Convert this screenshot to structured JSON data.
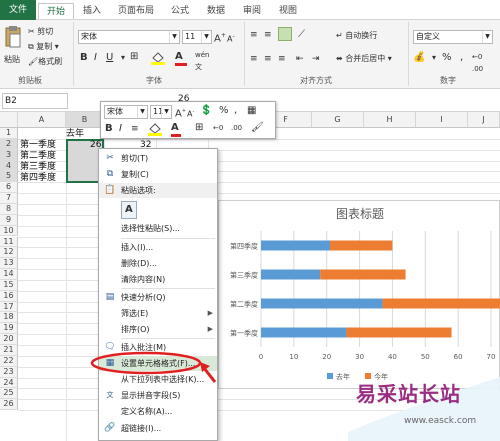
{
  "tabs": [
    "文件",
    "开始",
    "插入",
    "页面布局",
    "公式",
    "数据",
    "审阅",
    "视图"
  ],
  "ribbon": {
    "paste_label": "粘贴",
    "clipboard_items": [
      "剪切",
      "复制",
      "格式刷"
    ],
    "font_name": "宋体",
    "font_size": "11",
    "wrap_text": "自动换行",
    "merge_center": "合并后居中",
    "number_format": "自定义",
    "groups": [
      "剪贴板",
      "字体",
      "对齐方式",
      "数字"
    ],
    "icons": [
      "scissors-icon",
      "copy-icon",
      "brush-icon",
      "bold-icon",
      "italic-icon",
      "underline-icon",
      "border-icon",
      "fill-color-icon",
      "font-color-icon",
      "align-icon",
      "wrap-icon",
      "merge-icon",
      "currency-icon",
      "percent-icon",
      "comma-icon"
    ]
  },
  "formula_bar": {
    "name_box": "B2",
    "value": "26"
  },
  "mini_toolbar": {
    "font": "宋体",
    "size": "11",
    "percent": "%"
  },
  "columns": [
    "A",
    "B",
    "C",
    "D",
    "E",
    "F",
    "G",
    "H",
    "I",
    "J"
  ],
  "rows": [
    "1",
    "2",
    "3",
    "4",
    "5",
    "6",
    "7",
    "8",
    "9",
    "10",
    "11",
    "12",
    "13",
    "14",
    "15",
    "16",
    "17",
    "18",
    "19",
    "20",
    "21",
    "22",
    "23",
    "24",
    "25",
    "26"
  ],
  "cells": {
    "b1": "去年",
    "a2": "第一季度",
    "a3": "第二季度",
    "a4": "第三季度",
    "a5": "第四季度",
    "b2": "26",
    "c2": "32"
  },
  "context_menu": {
    "items": [
      {
        "label": "剪切(T)",
        "icon": "scissors-icon"
      },
      {
        "label": "复制(C)",
        "icon": "copy-icon"
      },
      {
        "label": "粘贴选项:",
        "icon": "paste-icon"
      },
      {
        "label": "",
        "icon": "paste-option-icon"
      },
      {
        "label": "选择性粘贴(S)...",
        "icon": ""
      },
      {
        "label": "插入(I)...",
        "icon": ""
      },
      {
        "label": "删除(D)...",
        "icon": ""
      },
      {
        "label": "清除内容(N)",
        "icon": ""
      },
      {
        "label": "快速分析(Q)",
        "icon": "quick-analysis-icon"
      },
      {
        "label": "筛选(E)",
        "icon": ""
      },
      {
        "label": "排序(O)",
        "icon": ""
      },
      {
        "label": "插入批注(M)",
        "icon": "comment-icon"
      },
      {
        "label": "设置单元格格式(F)...",
        "icon": "format-cells-icon"
      },
      {
        "label": "从下拉列表中选择(K)...",
        "icon": ""
      },
      {
        "label": "显示拼音字段(S)",
        "icon": "phonetic-icon"
      },
      {
        "label": "定义名称(A)...",
        "icon": ""
      },
      {
        "label": "超链接(I)...",
        "icon": "hyperlink-icon"
      }
    ]
  },
  "chart_data": {
    "type": "bar",
    "title": "图表标题",
    "categories": [
      "第一季度",
      "第二季度",
      "第三季度",
      "第四季度"
    ],
    "series": [
      {
        "name": "去年",
        "values": [
          26,
          37,
          18,
          21
        ],
        "color": "#5b9bd5"
      },
      {
        "name": "今年",
        "values": [
          32,
          36,
          26,
          19
        ],
        "color": "#ed7d31"
      }
    ],
    "xlim": [
      0,
      70
    ],
    "xticks": [
      "0",
      "10",
      "20",
      "30",
      "40",
      "50",
      "60",
      "70"
    ],
    "legend": "bottom"
  },
  "watermark": {
    "main": "易采站长站",
    "url": "www.easck.com"
  },
  "colors": {
    "accent": "#217346",
    "highlight": "#d9e9d8",
    "annotation": "#e02020"
  }
}
